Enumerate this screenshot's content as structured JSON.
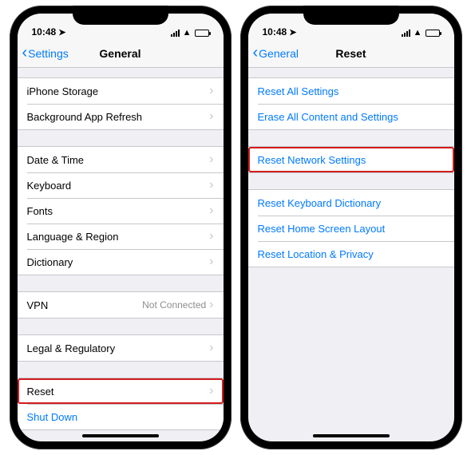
{
  "status": {
    "time": "10:48",
    "loc_icon": "➤",
    "wifi_icon": "▲",
    "signal_bars": 4
  },
  "phone1": {
    "back_label": "Settings",
    "title": "General",
    "groups": [
      {
        "rows": [
          {
            "label": "iPhone Storage",
            "chevron": true
          },
          {
            "label": "Background App Refresh",
            "chevron": true
          }
        ]
      },
      {
        "rows": [
          {
            "label": "Date & Time",
            "chevron": true
          },
          {
            "label": "Keyboard",
            "chevron": true
          },
          {
            "label": "Fonts",
            "chevron": true
          },
          {
            "label": "Language & Region",
            "chevron": true
          },
          {
            "label": "Dictionary",
            "chevron": true
          }
        ]
      },
      {
        "rows": [
          {
            "label": "VPN",
            "detail": "Not Connected",
            "chevron": true
          }
        ]
      },
      {
        "rows": [
          {
            "label": "Legal & Regulatory",
            "chevron": true
          }
        ]
      },
      {
        "rows": [
          {
            "label": "Reset",
            "chevron": true,
            "highlight": true
          },
          {
            "label": "Shut Down",
            "link": true
          }
        ]
      }
    ]
  },
  "phone2": {
    "back_label": "General",
    "title": "Reset",
    "groups": [
      {
        "rows": [
          {
            "label": "Reset All Settings",
            "link": true
          },
          {
            "label": "Erase All Content and Settings",
            "link": true
          }
        ]
      },
      {
        "rows": [
          {
            "label": "Reset Network Settings",
            "link": true,
            "highlight": true
          }
        ]
      },
      {
        "rows": [
          {
            "label": "Reset Keyboard Dictionary",
            "link": true
          },
          {
            "label": "Reset Home Screen Layout",
            "link": true
          },
          {
            "label": "Reset Location & Privacy",
            "link": true
          }
        ]
      }
    ]
  }
}
